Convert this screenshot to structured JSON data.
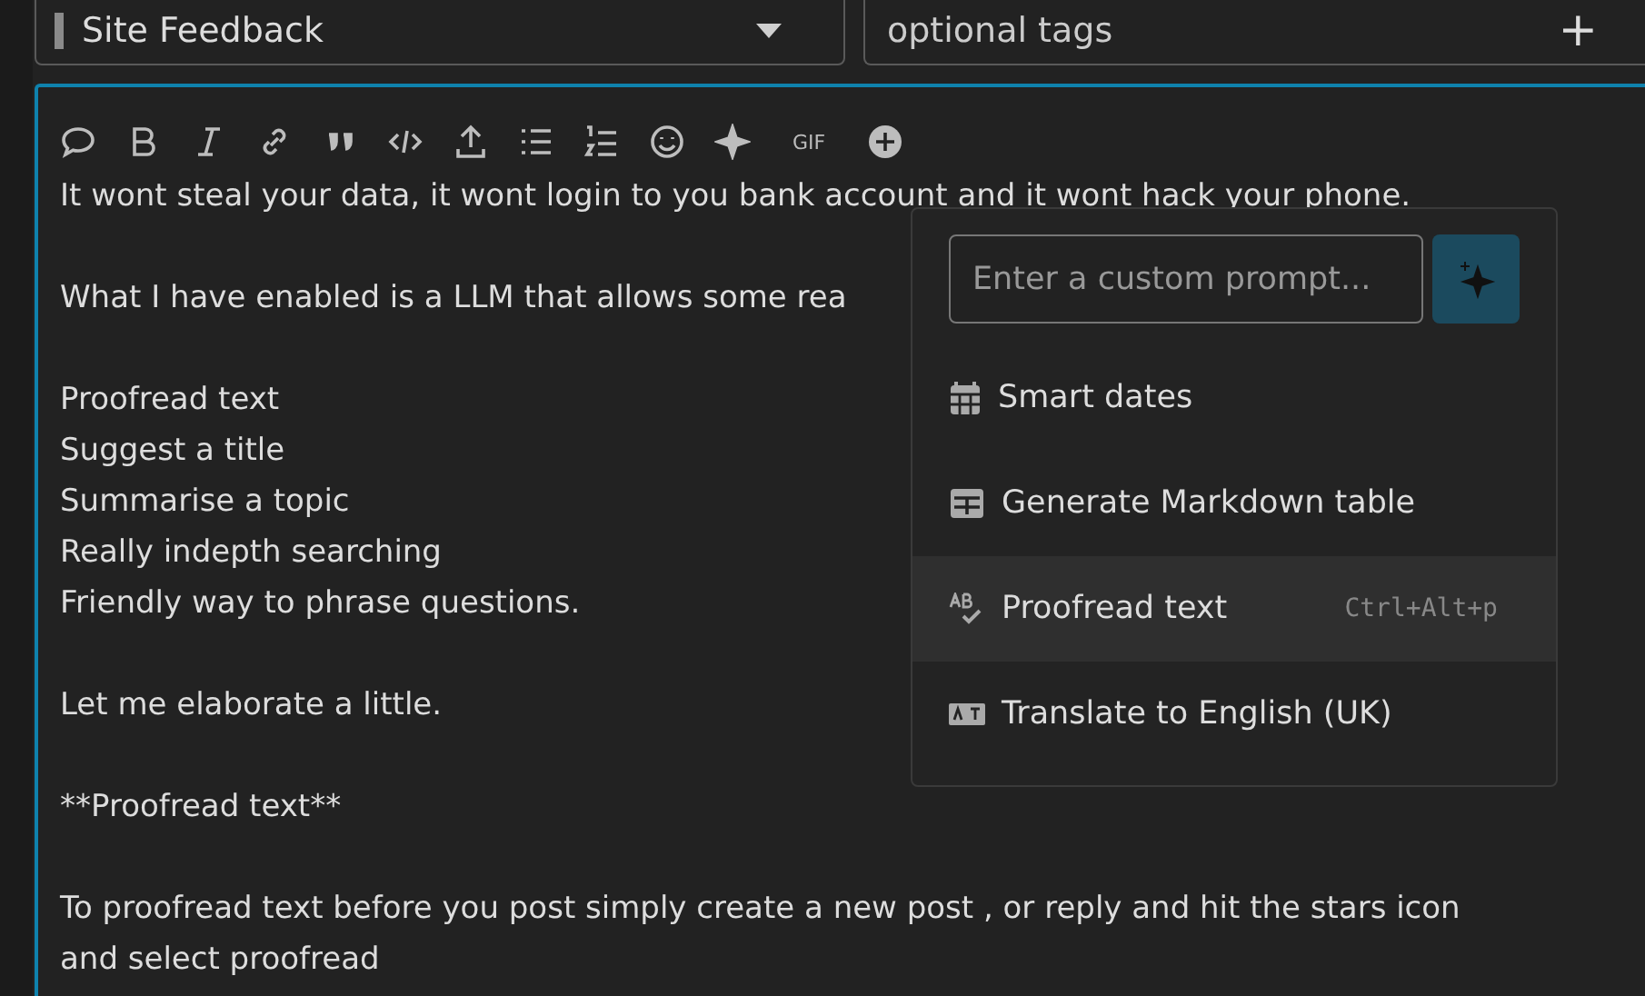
{
  "category": {
    "label": "Site Feedback"
  },
  "tags": {
    "placeholder": "optional tags",
    "add_symbol": "+"
  },
  "toolbar": [
    {
      "kind": "chat"
    },
    {
      "kind": "bold"
    },
    {
      "kind": "italic"
    },
    {
      "kind": "link"
    },
    {
      "kind": "quote"
    },
    {
      "kind": "code"
    },
    {
      "kind": "upload"
    },
    {
      "kind": "bullets"
    },
    {
      "kind": "numbers"
    },
    {
      "kind": "emoji"
    },
    {
      "kind": "ai"
    },
    {
      "kind": "gif",
      "label": "GIF"
    },
    {
      "kind": "more"
    }
  ],
  "paragraphs": [
    [
      "It wont steal your data, it wont login to you bank account and it wont hack your phone."
    ],
    [
      "What I have enabled is a LLM that allows some rea"
    ],
    [
      "Proofread text",
      "Suggest a title",
      "Summarise a topic",
      "Really indepth searching",
      "Friendly way to phrase questions."
    ],
    [
      "Let me elaborate a little."
    ],
    [
      "**Proofread text**"
    ],
    [
      "To proofread text before you post simply create a new post , or reply and hit the stars icon",
      "and select proofread"
    ]
  ],
  "ai_menu": {
    "prompt_placeholder": "Enter a custom prompt...",
    "items": [
      {
        "kind": "calendar",
        "label": "Smart dates",
        "selected": false
      },
      {
        "kind": "table",
        "label": "Generate Markdown table",
        "selected": false
      },
      {
        "kind": "proofread",
        "label": "Proofread text",
        "shortcut": "Ctrl+Alt+p",
        "selected": true
      },
      {
        "kind": "translate",
        "label": "Translate to English (UK)",
        "selected": false
      }
    ]
  }
}
